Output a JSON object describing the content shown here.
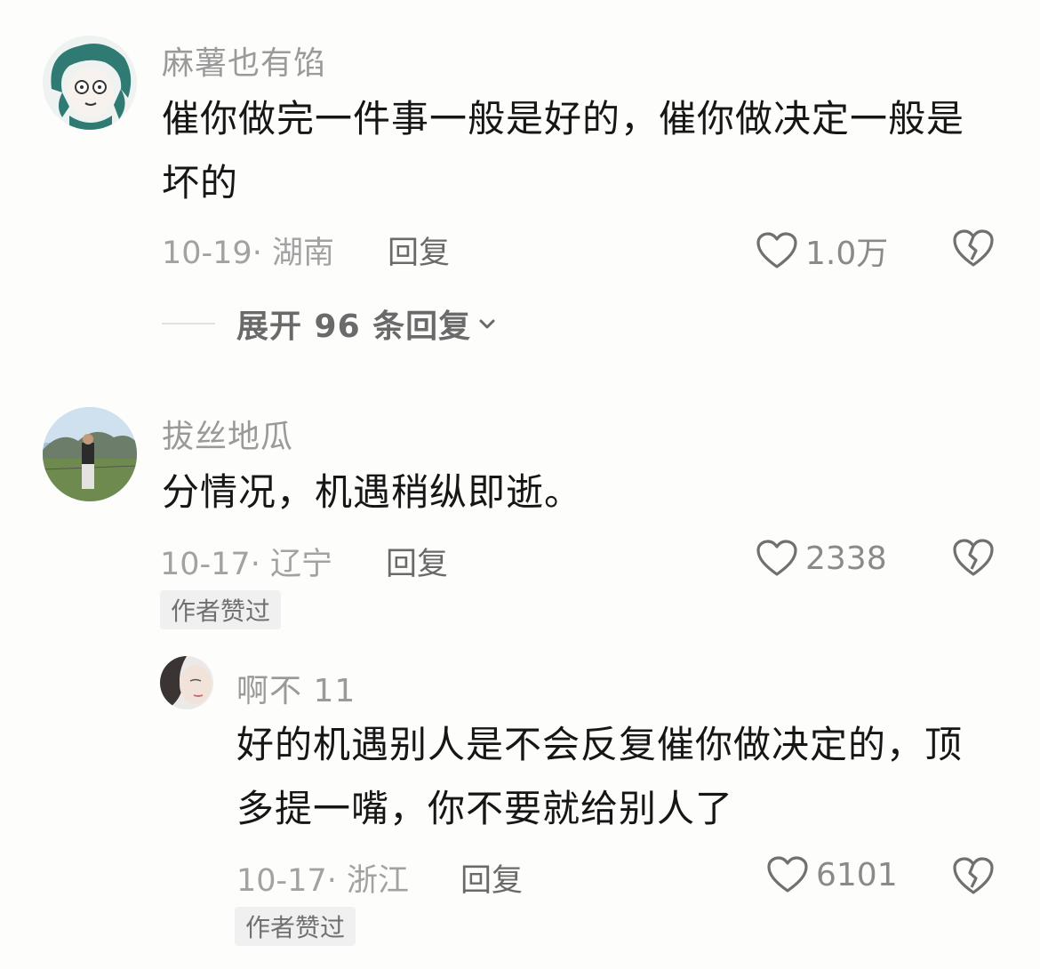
{
  "comments": [
    {
      "username": "麻薯也有馅",
      "text": "催你做完一件事一般是好的，催你做决定一般是坏的",
      "date_location": "10-19· 湖南",
      "reply_label": "回复",
      "likes": "1.0万",
      "expand_label": "展开 96 条回复",
      "avatar_icon": "anime-character-avatar"
    },
    {
      "username": "拔丝地瓜",
      "text": "分情况，机遇稍纵即逝。",
      "date_location": "10-17· 辽宁",
      "reply_label": "回复",
      "likes": "2338",
      "badge": "作者赞过",
      "avatar_icon": "landscape-person-avatar"
    },
    {
      "username": "啊不 11",
      "text": "好的机遇别人是不会反复催你做决定的，顶多提一嘴，你不要就给别人了",
      "date_location": "10-17· 浙江",
      "reply_label": "回复",
      "likes": "6101",
      "badge": "作者赞过",
      "avatar_icon": "portrait-face-avatar"
    }
  ],
  "icons": {
    "like": "heart-outline-icon",
    "dislike": "broken-heart-icon",
    "expand": "chevron-down-icon"
  },
  "colors": {
    "background": "#fdfdfb",
    "username": "#9a9a9a",
    "meta": "#a2a2a2",
    "icon": "#707070"
  }
}
